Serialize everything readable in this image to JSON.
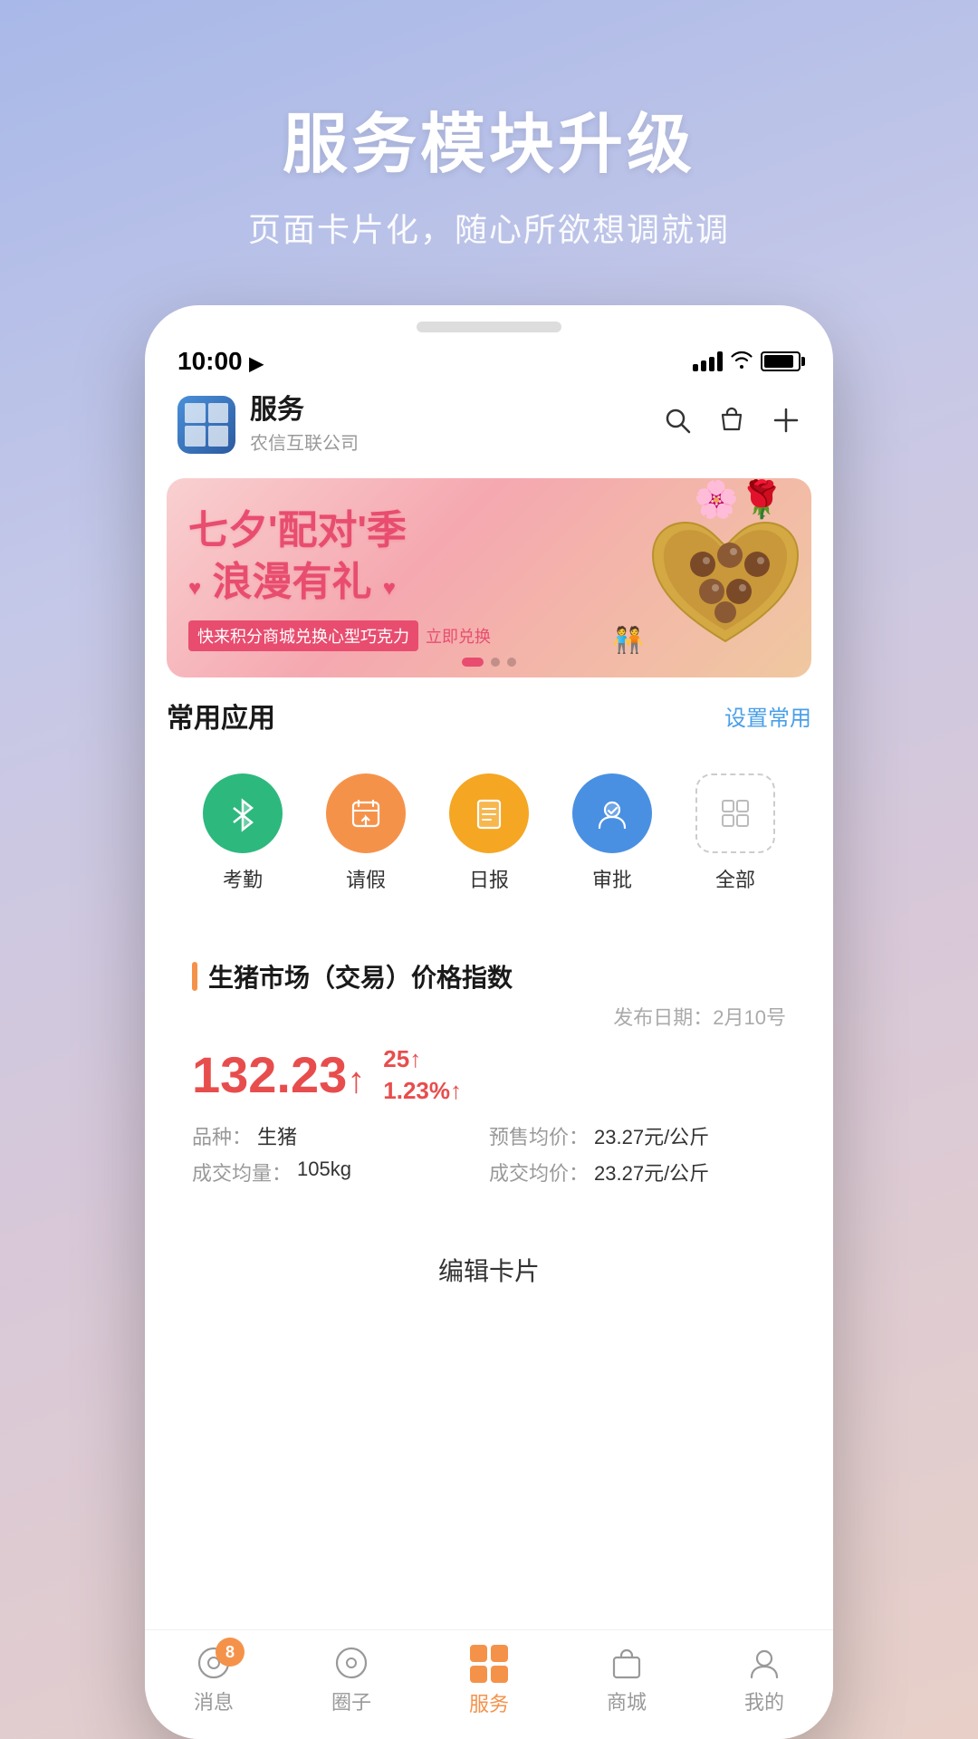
{
  "page": {
    "title": "服务模块升级",
    "subtitle": "页面卡片化，随心所欲想调就调"
  },
  "statusBar": {
    "time": "10:00",
    "locationArrow": "▶"
  },
  "appHeader": {
    "appName": "服务",
    "company": "农信互联公司",
    "searchLabel": "search",
    "bagLabel": "bag",
    "plusLabel": "plus"
  },
  "banner": {
    "title1": "七夕'配对'季",
    "title2": "浪漫有礼",
    "tagText": "快来积分商城兑换心型巧克力",
    "ctaText": "立即兑换",
    "dots": [
      true,
      false,
      false
    ]
  },
  "commonApps": {
    "sectionTitle": "常用应用",
    "actionLabel": "设置常用",
    "apps": [
      {
        "label": "考勤",
        "iconType": "bluetooth",
        "bgColor": "green"
      },
      {
        "label": "请假",
        "iconType": "calendar-stamp",
        "bgColor": "orange"
      },
      {
        "label": "日报",
        "iconType": "document",
        "bgColor": "amber"
      },
      {
        "label": "审批",
        "iconType": "person-check",
        "bgColor": "blue"
      },
      {
        "label": "全部",
        "iconType": "grid",
        "bgColor": "dashed"
      }
    ]
  },
  "priceCard": {
    "title": "生猪市场（交易）价格指数",
    "dateLabel": "发布日期：",
    "date": "2月10号",
    "mainValue": "132.23",
    "upArrow": "↑",
    "changeValue": "25↑",
    "changePercent": "1.23%↑",
    "details": [
      {
        "label": "品种：",
        "value": "生猪"
      },
      {
        "label": "预售均价：",
        "value": "23.27元/公斤"
      },
      {
        "label": "成交均量：",
        "value": "105kg"
      },
      {
        "label": "成交均价：",
        "value": "23.27元/公斤"
      }
    ]
  },
  "editCardBtn": "编辑卡片",
  "bottomNav": {
    "items": [
      {
        "label": "消息",
        "iconType": "message",
        "badge": "8",
        "active": false
      },
      {
        "label": "圈子",
        "iconType": "circle",
        "badge": null,
        "active": false
      },
      {
        "label": "服务",
        "iconType": "grid4",
        "badge": null,
        "active": true
      },
      {
        "label": "商城",
        "iconType": "shop",
        "badge": null,
        "active": false
      },
      {
        "label": "我的",
        "iconType": "person",
        "badge": null,
        "active": false
      }
    ]
  }
}
